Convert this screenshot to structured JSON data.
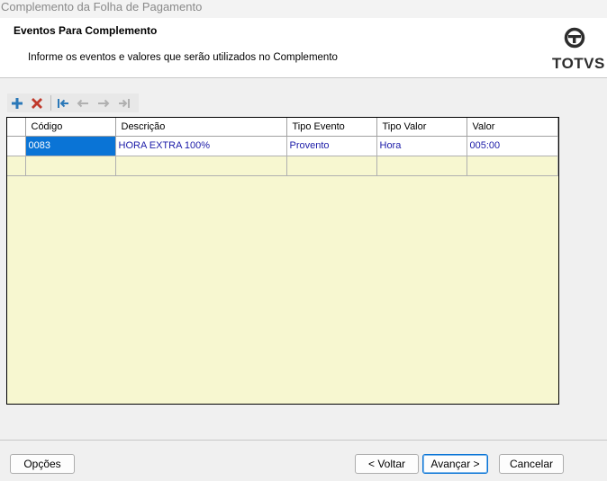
{
  "window": {
    "title": "Complemento da Folha de Pagamento"
  },
  "header": {
    "title": "Eventos Para Complemento",
    "subtitle": "Informe os eventos e valores que serão utilizados no Complemento",
    "logo_text": "TOTVS"
  },
  "toolbar": {
    "buttons": [
      {
        "name": "add",
        "icon": "plus-icon",
        "color": "#2a78b8"
      },
      {
        "name": "delete",
        "icon": "x-icon",
        "color": "#c0392b"
      },
      {
        "name": "first",
        "icon": "first-record-icon",
        "color": "#2a78b8"
      },
      {
        "name": "previous",
        "icon": "arrow-left-icon",
        "color": "#b0b0b0"
      },
      {
        "name": "next",
        "icon": "arrow-right-icon",
        "color": "#b0b0b0"
      },
      {
        "name": "last",
        "icon": "last-record-icon",
        "color": "#b0b0b0"
      }
    ]
  },
  "grid": {
    "columns": [
      "Código",
      "Descrição",
      "Tipo Evento",
      "Tipo Valor",
      "Valor"
    ],
    "rows": [
      {
        "codigo": "0083",
        "descricao": "HORA EXTRA 100%",
        "tipo_evento": "Provento",
        "tipo_valor": "Hora",
        "valor": "005:00"
      }
    ],
    "selected_color": "#0a74d6",
    "empty_color": "#f7f7d0"
  },
  "footer": {
    "options_label": "Opções",
    "back_label": "< Voltar",
    "next_label": "Avançar >",
    "cancel_label": "Cancelar"
  }
}
